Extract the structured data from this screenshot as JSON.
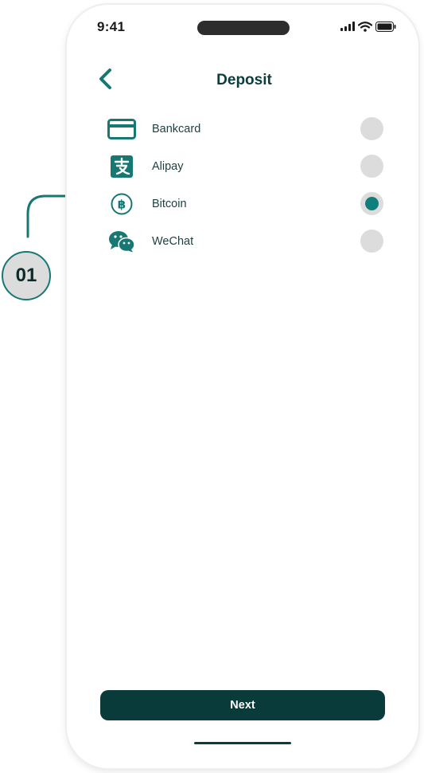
{
  "status_bar": {
    "time": "9:41"
  },
  "header": {
    "title": "Deposit",
    "back_icon": "chevron-left-icon"
  },
  "payment_options": [
    {
      "label": "Bankcard",
      "icon": "credit-card-icon",
      "selected": false
    },
    {
      "label": "Alipay",
      "icon": "alipay-icon",
      "selected": false
    },
    {
      "label": "Bitcoin",
      "icon": "bitcoin-icon",
      "selected": true
    },
    {
      "label": "WeChat",
      "icon": "wechat-icon",
      "selected": false
    }
  ],
  "footer": {
    "next_label": "Next"
  },
  "annotation": {
    "badge_label": "01"
  },
  "colors": {
    "accent": "#0f7f7c",
    "primary_dark": "#083b3a",
    "radio_idle": "#dcdcdc"
  }
}
